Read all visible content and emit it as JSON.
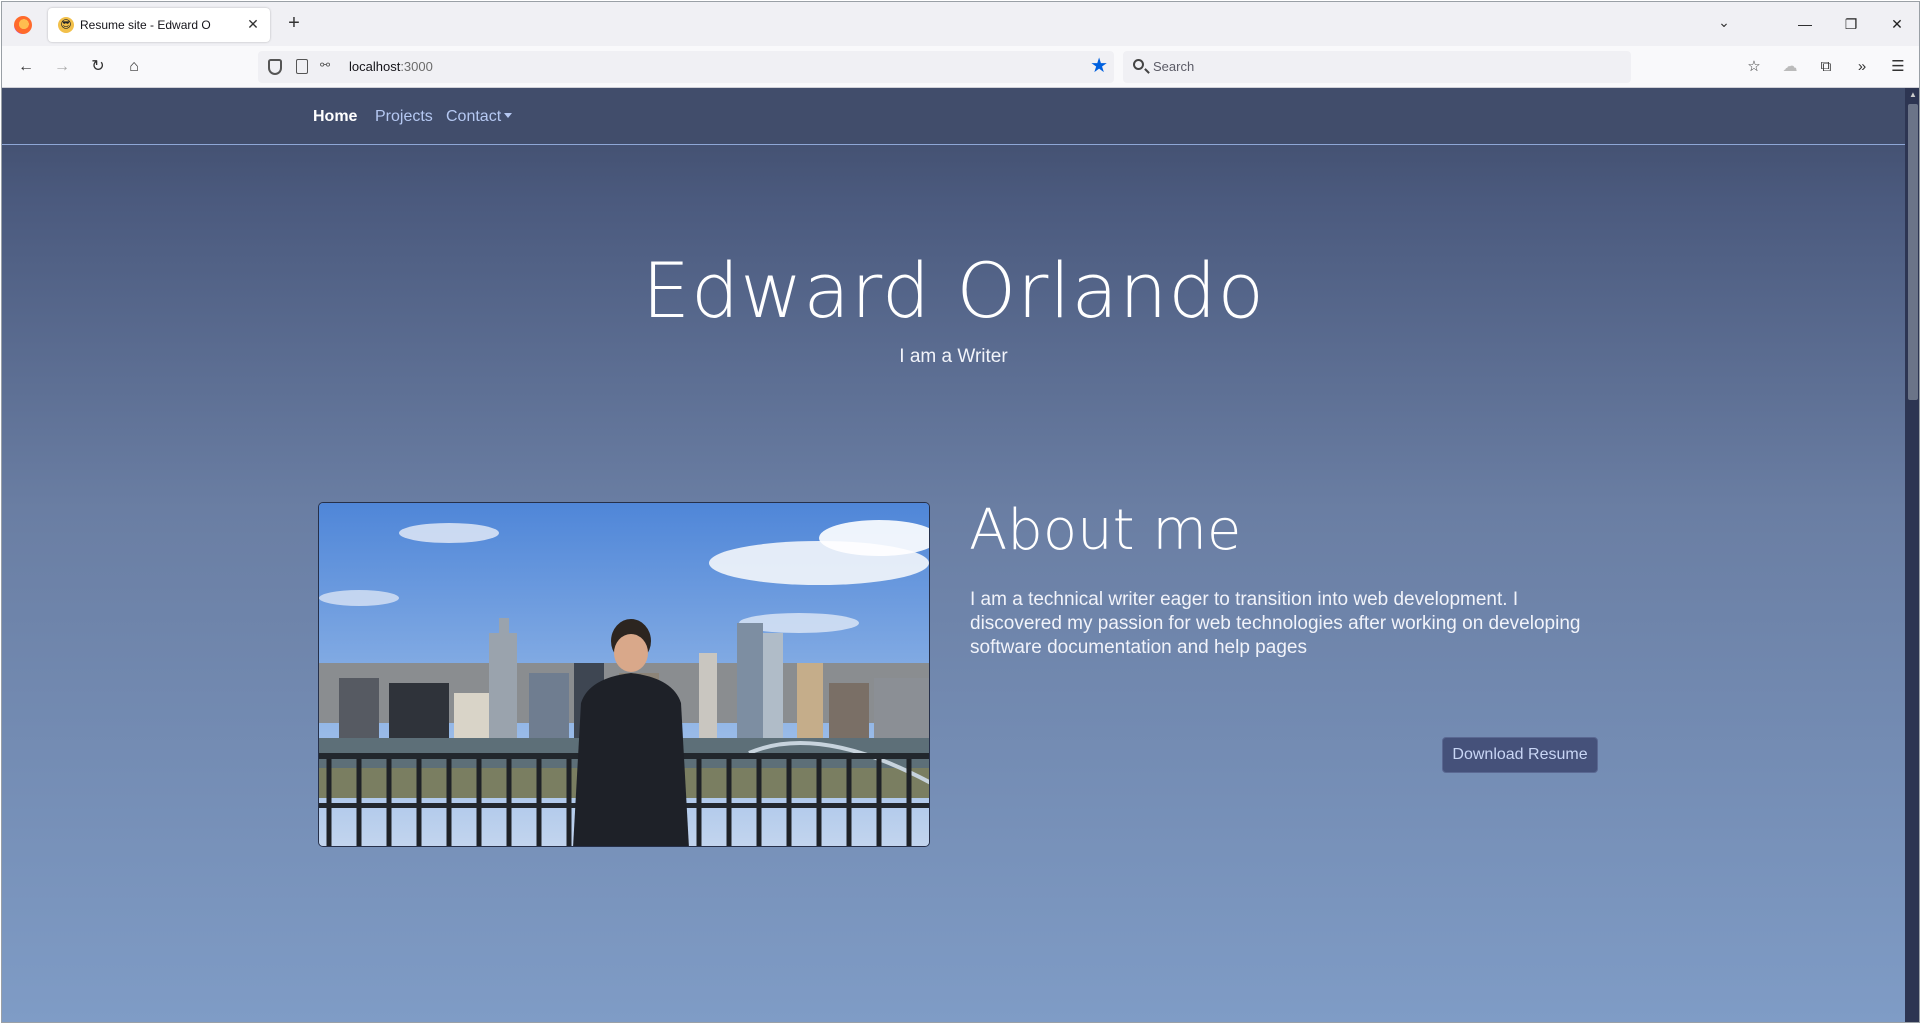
{
  "browser": {
    "tab_title": "Resume site - Edward O",
    "tab_favicon": "😎",
    "tab_close": "✕",
    "new_tab": "+",
    "url_host": "localhost",
    "url_port": ":3000",
    "search_placeholder": "Search",
    "icons": {
      "back": "←",
      "forward": "→",
      "reload": "↻",
      "home": "⌂",
      "bookmark_star": "★",
      "list_tabs": "⌄",
      "minimize": "—",
      "maximize": "❐",
      "close": "✕",
      "save_to_pocket": "☆",
      "account": "☁",
      "extensions": "⧉",
      "overflow": "»",
      "menu": "☰",
      "permissions": "⚯"
    }
  },
  "site": {
    "nav": {
      "home": "Home",
      "projects": "Projects",
      "contact": "Contact"
    },
    "hero": {
      "name": "Edward Orlando",
      "subtitle": "I am a Writer"
    },
    "about": {
      "title": "About me",
      "text": "I am a technical writer eager to transition into web development. I discovered my passion for web technologies after working on developing software documentation and help pages",
      "download_button": "Download Resume"
    }
  },
  "colors": {
    "nav_bg": "#414d6b",
    "link": "#b5c8f2",
    "button_bg": "#45517a",
    "url_star": "#0060df"
  }
}
